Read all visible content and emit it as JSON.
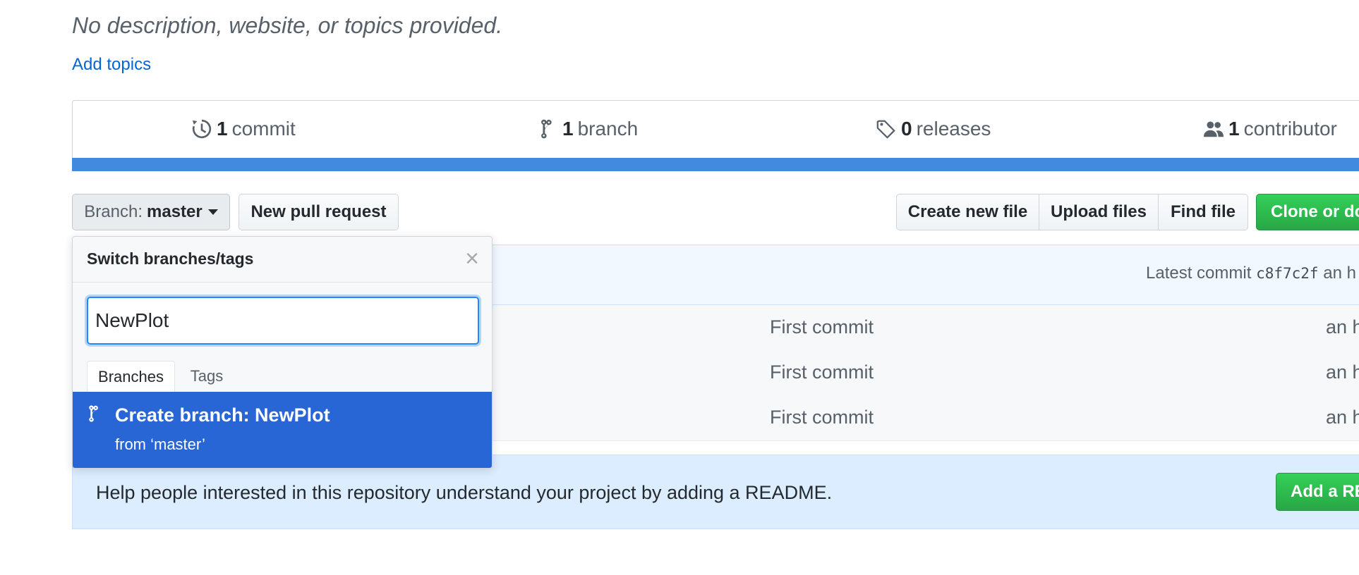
{
  "repo": {
    "description": "No description, website, or topics provided.",
    "add_topics": "Add topics"
  },
  "summary": {
    "commits": {
      "count": "1",
      "label": "commit",
      "icon": "history-icon"
    },
    "branches": {
      "count": "1",
      "label": "branch",
      "icon": "git-branch-icon"
    },
    "releases": {
      "count": "0",
      "label": "releases",
      "icon": "tag-icon"
    },
    "contributors": {
      "count": "1",
      "label": "contributor",
      "icon": "people-icon"
    },
    "language_bar_color": "#4289e0"
  },
  "toolbar": {
    "branch_prefix": "Branch:",
    "branch_name": "master",
    "new_pull_request": "New pull request",
    "create_new_file": "Create new file",
    "upload_files": "Upload files",
    "find_file": "Find file",
    "clone_or_download": "Clone or do"
  },
  "latest_commit": {
    "label": "Latest commit",
    "sha": "c8f7c2f",
    "trailing": "an h"
  },
  "files": [
    {
      "message": "First commit",
      "age": "an h"
    },
    {
      "message": "First commit",
      "age": "an h"
    },
    {
      "message": "First commit",
      "age": "an h"
    }
  ],
  "readme_prompt": {
    "text": "Help people interested in this repository understand your project by adding a README.",
    "button": "Add a RE"
  },
  "branch_dropdown": {
    "title": "Switch branches/tags",
    "close": "×",
    "filter_value": "NewPlot",
    "tabs": [
      "Branches",
      "Tags"
    ],
    "create_label": "Create branch: NewPlot",
    "create_from": "from ‘master’"
  }
}
